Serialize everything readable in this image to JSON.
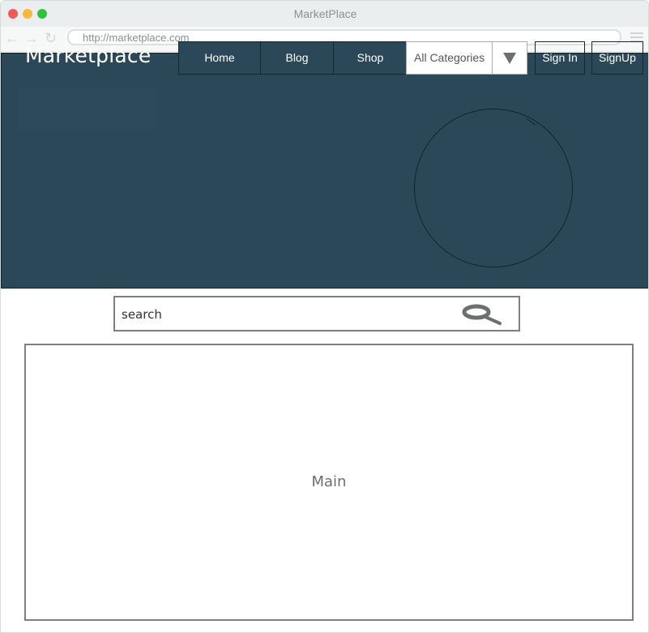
{
  "window": {
    "title": "MarketPlace"
  },
  "address_bar": {
    "url": "http://marketplace.com"
  },
  "header": {
    "logo": "Marketplace",
    "nav": {
      "home": "Home",
      "blog": "Blog",
      "shop": "Shop"
    },
    "category_select": {
      "selected": "All Categories"
    },
    "sign_in": "Sign In",
    "sign_up": "SignUp"
  },
  "search": {
    "placeholder": "search"
  },
  "main": {
    "label": "Main"
  },
  "colors": {
    "header_bg": "#2b4858",
    "border_dark": "#16262f"
  }
}
